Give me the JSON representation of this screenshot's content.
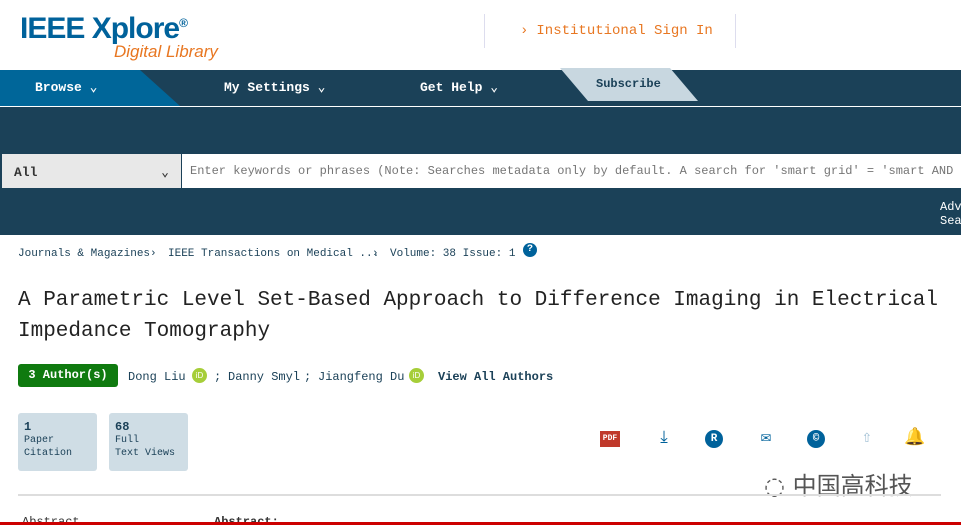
{
  "header": {
    "logo_main": "IEEE Xplore",
    "logo_sub": "Digital Library",
    "signin": "Institutional Sign In"
  },
  "nav": {
    "items": [
      "Browse",
      "My Settings",
      "Get Help"
    ],
    "subscribe": "Subscribe"
  },
  "search": {
    "scope": "All",
    "placeholder": "Enter keywords or phrases (Note: Searches metadata only by default. A search for 'smart grid' = 'smart AND grid')",
    "advanced": "Advanced Search"
  },
  "breadcrumb": [
    "Journals & Magazines",
    "IEEE Transactions on Medical ...",
    "Volume: 38 Issue: 1"
  ],
  "article": {
    "title": "A Parametric Level Set-Based Approach to Difference Imaging in Electrical Impedance Tomography",
    "authors_badge": "3 Author(s)",
    "authors": [
      "Dong Liu",
      "Danny Smyl",
      "Jiangfeng Du"
    ],
    "view_all": "View All Authors"
  },
  "metrics": [
    {
      "value": "1",
      "label1": "Paper",
      "label2": "Citation"
    },
    {
      "value": "68",
      "label1": "Full",
      "label2": "Text Views"
    }
  ],
  "actions": [
    "pdf-icon",
    "download-icon",
    "rights-icon",
    "email-icon",
    "copyright-icon",
    "share-icon",
    "alert-bell-icon"
  ],
  "tabs": {
    "left": "Abstract",
    "right": "Abstract:"
  },
  "watermark": "中国高科技",
  "colors": {
    "brand": "#00629b",
    "nav": "#1b4158",
    "orange": "#e87722",
    "badge": "#0f7a0f"
  }
}
